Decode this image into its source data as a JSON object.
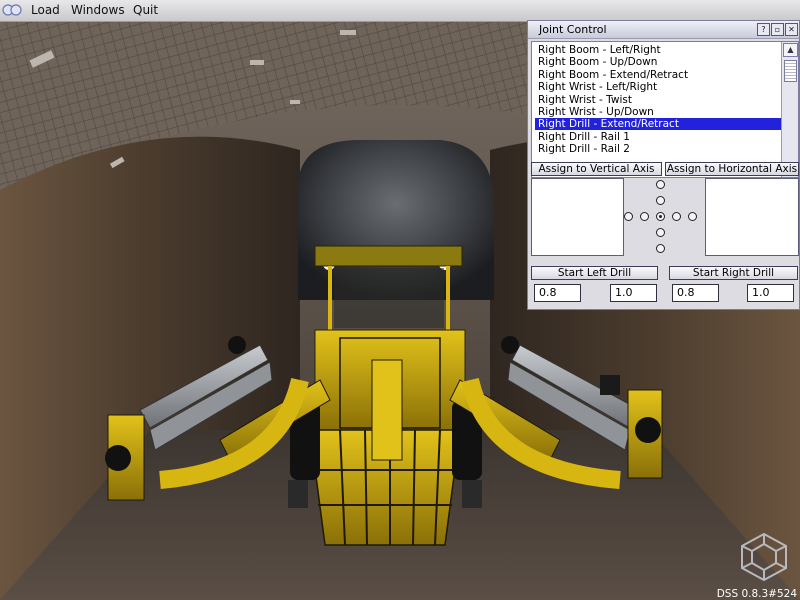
{
  "menu": {
    "items": [
      "Load",
      "Windows",
      "Quit"
    ]
  },
  "window": {
    "title": "Joint Control",
    "joints": [
      "Right Boom - Left/Right",
      "Right Boom - Up/Down",
      "Right Boom - Extend/Retract",
      "Right Wrist - Left/Right",
      "Right Wrist - Twist",
      "Right Wrist - Up/Down",
      "Right Drill - Extend/Retract",
      "Right Drill - Rail 1",
      "Right Drill - Rail 2"
    ],
    "selected_index": 6,
    "assign_vertical": "Assign to Vertical Axis",
    "assign_horizontal": "Assign to Horizontal Axis",
    "start_left": "Start Left Drill",
    "start_right": "Start Right Drill",
    "left_values": [
      "0.8",
      "1.0"
    ],
    "right_values": [
      "0.8",
      "1.0"
    ]
  },
  "version": "DSS 0.8.3#524",
  "colors": {
    "selection": "#2222dd",
    "machine_yellow": "#c9a70a"
  }
}
